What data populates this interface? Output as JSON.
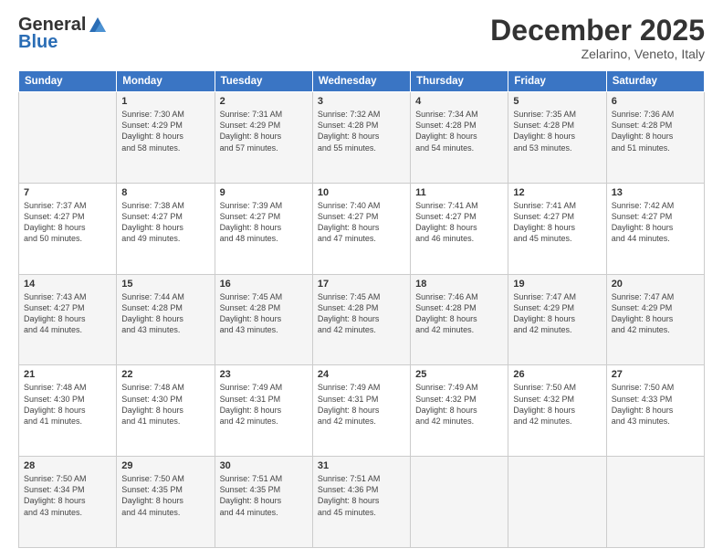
{
  "logo": {
    "general": "General",
    "blue": "Blue"
  },
  "header": {
    "month": "December 2025",
    "location": "Zelarino, Veneto, Italy"
  },
  "days_of_week": [
    "Sunday",
    "Monday",
    "Tuesday",
    "Wednesday",
    "Thursday",
    "Friday",
    "Saturday"
  ],
  "weeks": [
    [
      {
        "day": "",
        "info": ""
      },
      {
        "day": "1",
        "info": "Sunrise: 7:30 AM\nSunset: 4:29 PM\nDaylight: 8 hours\nand 58 minutes."
      },
      {
        "day": "2",
        "info": "Sunrise: 7:31 AM\nSunset: 4:29 PM\nDaylight: 8 hours\nand 57 minutes."
      },
      {
        "day": "3",
        "info": "Sunrise: 7:32 AM\nSunset: 4:28 PM\nDaylight: 8 hours\nand 55 minutes."
      },
      {
        "day": "4",
        "info": "Sunrise: 7:34 AM\nSunset: 4:28 PM\nDaylight: 8 hours\nand 54 minutes."
      },
      {
        "day": "5",
        "info": "Sunrise: 7:35 AM\nSunset: 4:28 PM\nDaylight: 8 hours\nand 53 minutes."
      },
      {
        "day": "6",
        "info": "Sunrise: 7:36 AM\nSunset: 4:28 PM\nDaylight: 8 hours\nand 51 minutes."
      }
    ],
    [
      {
        "day": "7",
        "info": "Sunrise: 7:37 AM\nSunset: 4:27 PM\nDaylight: 8 hours\nand 50 minutes."
      },
      {
        "day": "8",
        "info": "Sunrise: 7:38 AM\nSunset: 4:27 PM\nDaylight: 8 hours\nand 49 minutes."
      },
      {
        "day": "9",
        "info": "Sunrise: 7:39 AM\nSunset: 4:27 PM\nDaylight: 8 hours\nand 48 minutes."
      },
      {
        "day": "10",
        "info": "Sunrise: 7:40 AM\nSunset: 4:27 PM\nDaylight: 8 hours\nand 47 minutes."
      },
      {
        "day": "11",
        "info": "Sunrise: 7:41 AM\nSunset: 4:27 PM\nDaylight: 8 hours\nand 46 minutes."
      },
      {
        "day": "12",
        "info": "Sunrise: 7:41 AM\nSunset: 4:27 PM\nDaylight: 8 hours\nand 45 minutes."
      },
      {
        "day": "13",
        "info": "Sunrise: 7:42 AM\nSunset: 4:27 PM\nDaylight: 8 hours\nand 44 minutes."
      }
    ],
    [
      {
        "day": "14",
        "info": "Sunrise: 7:43 AM\nSunset: 4:27 PM\nDaylight: 8 hours\nand 44 minutes."
      },
      {
        "day": "15",
        "info": "Sunrise: 7:44 AM\nSunset: 4:28 PM\nDaylight: 8 hours\nand 43 minutes."
      },
      {
        "day": "16",
        "info": "Sunrise: 7:45 AM\nSunset: 4:28 PM\nDaylight: 8 hours\nand 43 minutes."
      },
      {
        "day": "17",
        "info": "Sunrise: 7:45 AM\nSunset: 4:28 PM\nDaylight: 8 hours\nand 42 minutes."
      },
      {
        "day": "18",
        "info": "Sunrise: 7:46 AM\nSunset: 4:28 PM\nDaylight: 8 hours\nand 42 minutes."
      },
      {
        "day": "19",
        "info": "Sunrise: 7:47 AM\nSunset: 4:29 PM\nDaylight: 8 hours\nand 42 minutes."
      },
      {
        "day": "20",
        "info": "Sunrise: 7:47 AM\nSunset: 4:29 PM\nDaylight: 8 hours\nand 42 minutes."
      }
    ],
    [
      {
        "day": "21",
        "info": "Sunrise: 7:48 AM\nSunset: 4:30 PM\nDaylight: 8 hours\nand 41 minutes."
      },
      {
        "day": "22",
        "info": "Sunrise: 7:48 AM\nSunset: 4:30 PM\nDaylight: 8 hours\nand 41 minutes."
      },
      {
        "day": "23",
        "info": "Sunrise: 7:49 AM\nSunset: 4:31 PM\nDaylight: 8 hours\nand 42 minutes."
      },
      {
        "day": "24",
        "info": "Sunrise: 7:49 AM\nSunset: 4:31 PM\nDaylight: 8 hours\nand 42 minutes."
      },
      {
        "day": "25",
        "info": "Sunrise: 7:49 AM\nSunset: 4:32 PM\nDaylight: 8 hours\nand 42 minutes."
      },
      {
        "day": "26",
        "info": "Sunrise: 7:50 AM\nSunset: 4:32 PM\nDaylight: 8 hours\nand 42 minutes."
      },
      {
        "day": "27",
        "info": "Sunrise: 7:50 AM\nSunset: 4:33 PM\nDaylight: 8 hours\nand 43 minutes."
      }
    ],
    [
      {
        "day": "28",
        "info": "Sunrise: 7:50 AM\nSunset: 4:34 PM\nDaylight: 8 hours\nand 43 minutes."
      },
      {
        "day": "29",
        "info": "Sunrise: 7:50 AM\nSunset: 4:35 PM\nDaylight: 8 hours\nand 44 minutes."
      },
      {
        "day": "30",
        "info": "Sunrise: 7:51 AM\nSunset: 4:35 PM\nDaylight: 8 hours\nand 44 minutes."
      },
      {
        "day": "31",
        "info": "Sunrise: 7:51 AM\nSunset: 4:36 PM\nDaylight: 8 hours\nand 45 minutes."
      },
      {
        "day": "",
        "info": ""
      },
      {
        "day": "",
        "info": ""
      },
      {
        "day": "",
        "info": ""
      }
    ]
  ]
}
